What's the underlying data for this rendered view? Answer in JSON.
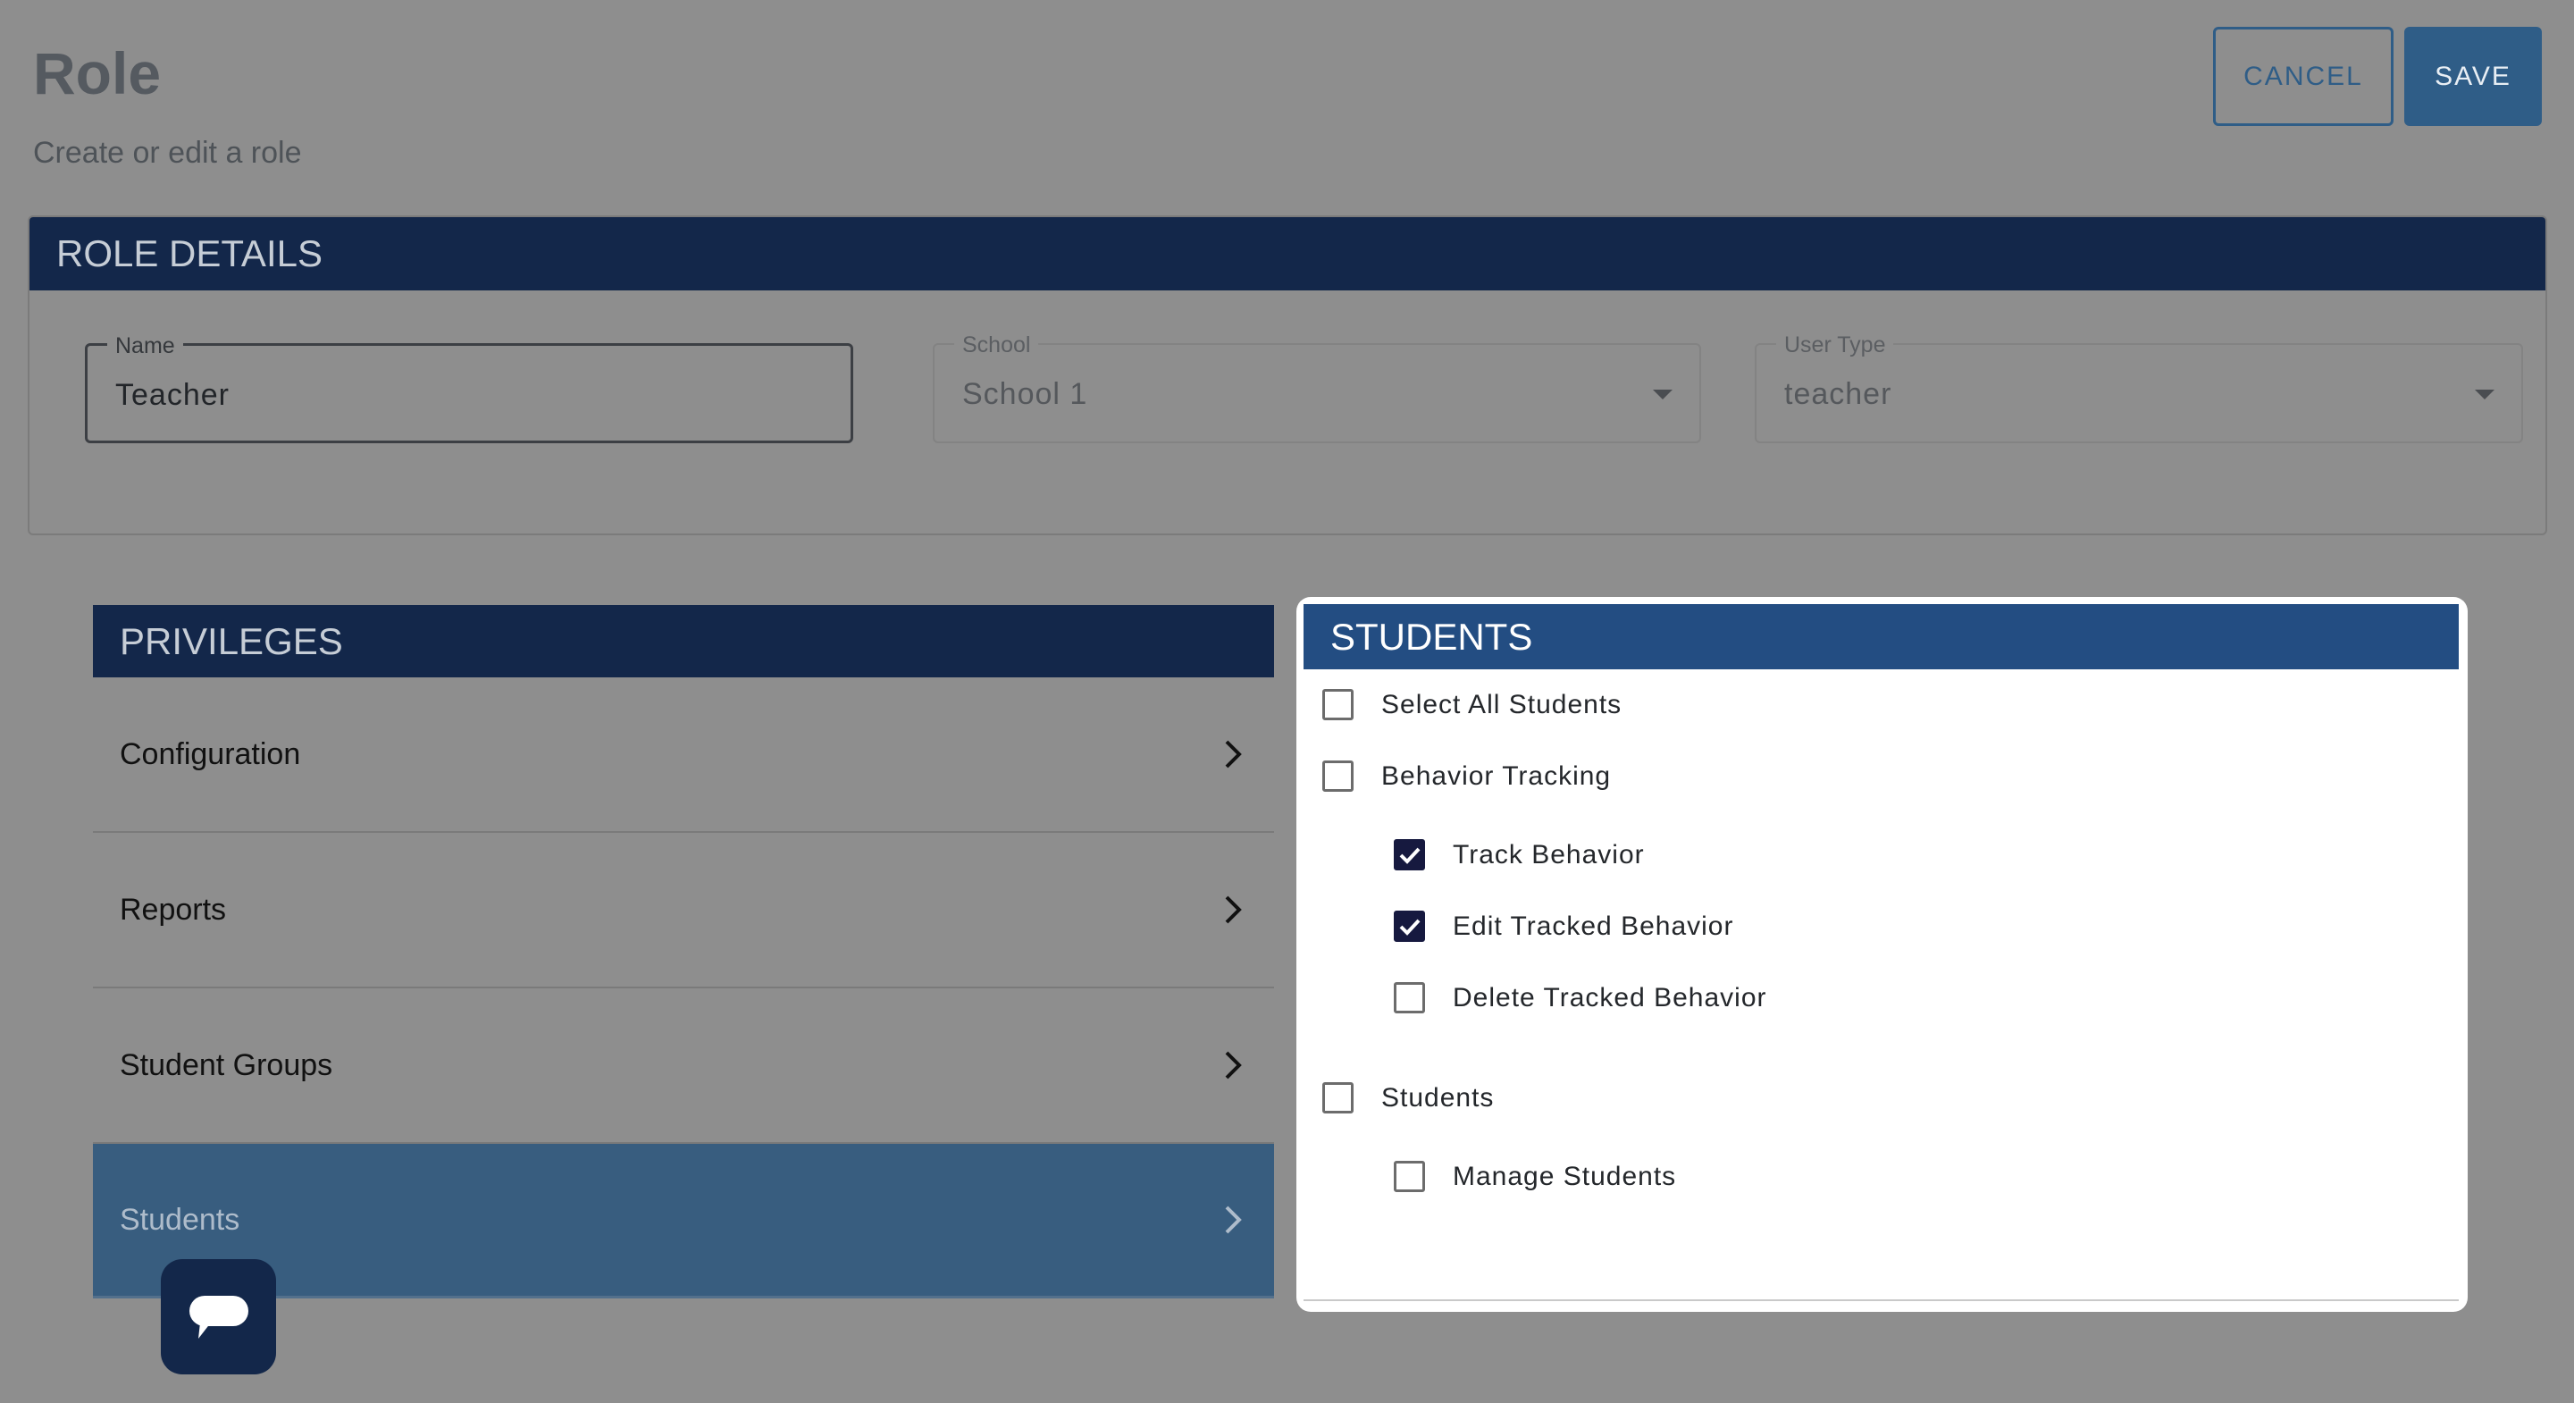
{
  "header": {
    "title": "Role",
    "subtitle": "Create or edit a role",
    "cancel_label": "CANCEL",
    "save_label": "SAVE"
  },
  "role_details": {
    "title": "ROLE DETAILS",
    "name": {
      "label": "Name",
      "value": "Teacher"
    },
    "school": {
      "label": "School",
      "value": "School 1"
    },
    "user_type": {
      "label": "User Type",
      "value": "teacher"
    }
  },
  "privileges": {
    "title": "PRIVILEGES",
    "items": [
      {
        "label": "Configuration"
      },
      {
        "label": "Reports"
      },
      {
        "label": "Student Groups"
      },
      {
        "label": "Students",
        "active": true
      }
    ]
  },
  "students_panel": {
    "title": "STUDENTS",
    "options": [
      {
        "label": "Select All Students",
        "checked": false
      },
      {
        "label": "Behavior Tracking",
        "checked": false
      },
      {
        "label": "Track Behavior",
        "checked": true
      },
      {
        "label": "Edit Tracked Behavior",
        "checked": true
      },
      {
        "label": "Delete Tracked Behavior",
        "checked": false
      },
      {
        "label": "Students",
        "checked": false
      },
      {
        "label": "Manage Students",
        "checked": false
      }
    ]
  },
  "colors": {
    "navy_header": "#13274a",
    "panel_header": "#234d82",
    "accent": "#2f5d87",
    "checked_box": "#16193f"
  },
  "icons": {
    "chevron": "chevron-right-icon",
    "chat": "chat-bubble-icon",
    "dropdown": "caret-down-icon",
    "check": "check-icon"
  }
}
